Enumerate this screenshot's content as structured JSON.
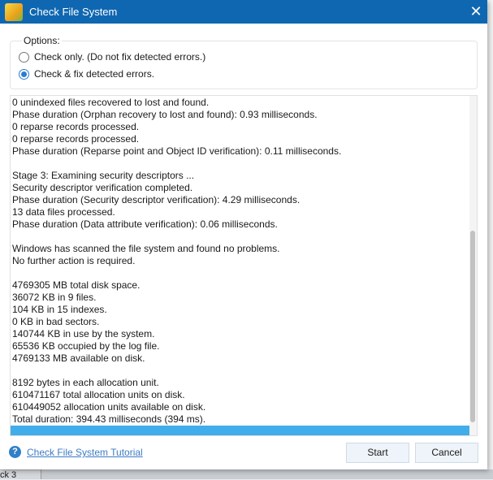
{
  "window": {
    "title": "Check File System",
    "close": "✕"
  },
  "background": {
    "status_text": "ck 3"
  },
  "options": {
    "legend": "Options:",
    "radios": [
      {
        "label": "Check only. (Do not fix detected errors.)",
        "selected": false
      },
      {
        "label": "Check & fix detected errors.",
        "selected": true
      }
    ]
  },
  "log": {
    "lines": [
      "0 unindexed files recovered to lost and found.",
      "Phase duration (Orphan recovery to lost and found): 0.93 milliseconds.",
      "0 reparse records processed.",
      "0 reparse records processed.",
      "Phase duration (Reparse point and Object ID verification): 0.11 milliseconds.",
      "",
      "Stage 3: Examining security descriptors ...",
      "Security descriptor verification completed.",
      "Phase duration (Security descriptor verification): 4.29 milliseconds.",
      "13 data files processed.",
      "Phase duration (Data attribute verification): 0.06 milliseconds.",
      "",
      "Windows has scanned the file system and found no problems.",
      "No further action is required.",
      "",
      "4769305 MB total disk space.",
      "36072 KB in 9 files.",
      "104 KB in 15 indexes.",
      "0 KB in bad sectors.",
      "140744 KB in use by the system.",
      "65536 KB occupied by the log file.",
      "4769133 MB available on disk.",
      "",
      "8192 bytes in each allocation unit.",
      "610471167 total allocation units on disk.",
      "610449052 allocation units available on disk.",
      "Total duration: 394.43 milliseconds (394 ms)."
    ],
    "progress_percent": 100
  },
  "footer": {
    "help_icon": "?",
    "tutorial_link": "Check File System Tutorial",
    "start": "Start",
    "cancel": "Cancel"
  }
}
